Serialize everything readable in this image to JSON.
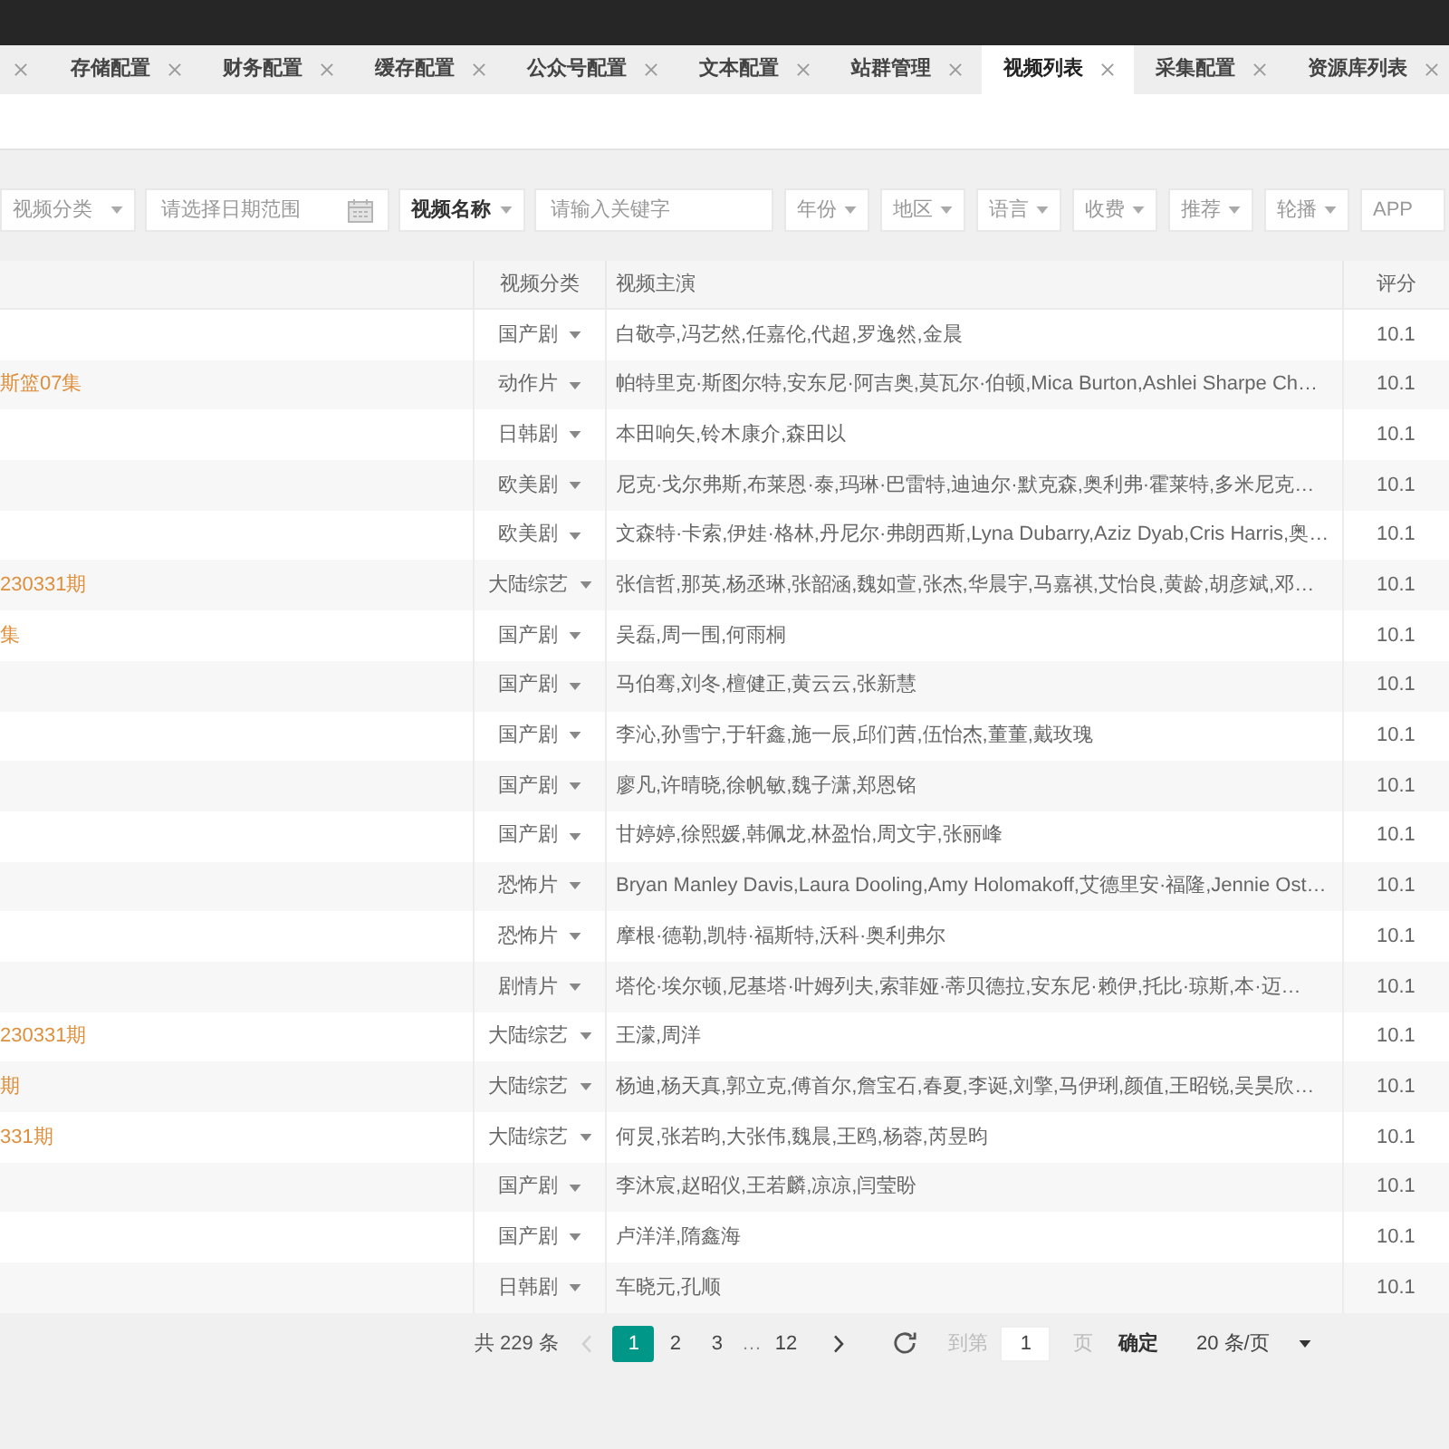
{
  "tabs": [
    {
      "label": "存储配置",
      "selected": false
    },
    {
      "label": "财务配置",
      "selected": false
    },
    {
      "label": "缓存配置",
      "selected": false
    },
    {
      "label": "公众号配置",
      "selected": false
    },
    {
      "label": "文本配置",
      "selected": false
    },
    {
      "label": "站群管理",
      "selected": false
    },
    {
      "label": "视频列表",
      "selected": true
    },
    {
      "label": "采集配置",
      "selected": false
    },
    {
      "label": "资源库列表",
      "selected": false
    }
  ],
  "filters": [
    {
      "kind": "select",
      "placeholder": "视频分类"
    },
    {
      "kind": "date",
      "placeholder": "请选择日期范围"
    },
    {
      "kind": "select",
      "value": "视频名称"
    },
    {
      "kind": "input",
      "placeholder": "请输入关键字"
    },
    {
      "kind": "select",
      "placeholder": "年份"
    },
    {
      "kind": "select",
      "placeholder": "地区"
    },
    {
      "kind": "select",
      "placeholder": "语言"
    },
    {
      "kind": "select",
      "placeholder": "收费"
    },
    {
      "kind": "select",
      "placeholder": "推荐"
    },
    {
      "kind": "select",
      "placeholder": "轮播"
    },
    {
      "kind": "select",
      "placeholder": "APP"
    }
  ],
  "table": {
    "columns": [
      "视频分类",
      "视频主演",
      "评分"
    ],
    "rows": [
      {
        "category": "国产剧",
        "actors": "白敬亭,冯艺然,任嘉伦,代超,罗逸然,金晨",
        "score": "10.1"
      },
      {
        "title": "斯篮07集",
        "category": "动作片",
        "actors": "帕特里克·斯图尔特,安东尼·阿吉奥,莫瓦尔·伯顿,Mica Burton,Ashlei Sharpe Ch…",
        "score": "10.1"
      },
      {
        "category": "日韩剧",
        "actors": "本田响矢,铃木康介,森田以",
        "score": "10.1"
      },
      {
        "category": "欧美剧",
        "actors": "尼克·戈尔弗斯,布莱恩·泰,玛琳·巴雷特,迪迪尔·默克森,奥利弗·霍莱特,多米尼克…",
        "score": "10.1"
      },
      {
        "category": "欧美剧",
        "actors": "文森特·卡索,伊娃·格林,丹尼尔·弗朗西斯,Lyna Dubarry,Aziz Dyab,Cris Harris,奥…",
        "score": "10.1"
      },
      {
        "title": "230331期",
        "category": "大陆综艺",
        "actors": "张信哲,那英,杨丞琳,张韶涵,魏如萱,张杰,华晨宇,马嘉祺,艾怡良,黄龄,胡彦斌,邓…",
        "score": "10.1"
      },
      {
        "title": "集",
        "category": "国产剧",
        "actors": "吴磊,周一围,何雨桐",
        "score": "10.1"
      },
      {
        "category": "国产剧",
        "actors": "马伯骞,刘冬,檀健正,黄云云,张新慧",
        "score": "10.1"
      },
      {
        "category": "国产剧",
        "actors": "李沁,孙雪宁,于轩鑫,施一辰,邱们茜,伍怡杰,董董,戴玫瑰",
        "score": "10.1"
      },
      {
        "category": "国产剧",
        "actors": "廖凡,许晴晓,徐帆敏,魏子潇,郑恩铭",
        "score": "10.1"
      },
      {
        "category": "国产剧",
        "actors": "甘婷婷,徐熙媛,韩佩龙,林盈怡,周文宇,张丽峰",
        "score": "10.1"
      },
      {
        "category": "恐怖片",
        "actors": "Bryan Manley Davis,Laura Dooling,Amy Holomakoff,艾德里安·福隆,Jennie Ost…",
        "score": "10.1"
      },
      {
        "category": "恐怖片",
        "actors": "摩根·德勒,凯特·福斯特,沃科·奥利弗尔",
        "score": "10.1"
      },
      {
        "category": "剧情片",
        "actors": "塔伦·埃尔顿,尼基塔·叶姆列夫,索菲娅·蒂贝德拉,安东尼·赖伊,托比·琼斯,本·迈…",
        "score": "10.1"
      },
      {
        "title": "230331期",
        "category": "大陆综艺",
        "actors": "王濛,周洋",
        "score": "10.1"
      },
      {
        "title": "期",
        "category": "大陆综艺",
        "actors": "杨迪,杨天真,郭立克,傅首尔,詹宝石,春夏,李诞,刘擎,马伊琍,颜值,王昭锐,吴昊欣…",
        "score": "10.1"
      },
      {
        "title": "331期",
        "category": "大陆综艺",
        "actors": "何炅,张若昀,大张伟,魏晨,王鸥,杨蓉,芮昱昀",
        "score": "10.1"
      },
      {
        "category": "国产剧",
        "actors": "李沐宸,赵昭仪,王若麟,凉凉,闫莹盼",
        "score": "10.1"
      },
      {
        "category": "国产剧",
        "actors": "卢洋洋,隋鑫海",
        "score": "10.1"
      },
      {
        "category": "日韩剧",
        "actors": "车晓元,孔顺",
        "score": "10.1"
      }
    ]
  },
  "pagination": {
    "total": "共 229 条",
    "prev": {
      "disabled": true
    },
    "pages": [
      {
        "kind": "page",
        "label": "1",
        "selected": true
      },
      {
        "kind": "page",
        "label": "2",
        "selected": false
      },
      {
        "kind": "page",
        "label": "3",
        "selected": false
      },
      {
        "kind": "ellipsis",
        "label": "…"
      },
      {
        "kind": "page",
        "label": "12",
        "selected": false
      }
    ],
    "next": {
      "disabled": false
    },
    "jump_label": "到第",
    "jump_value": "1",
    "jump_unit": "页",
    "confirm": "确定",
    "page_size": "20 条/页"
  }
}
